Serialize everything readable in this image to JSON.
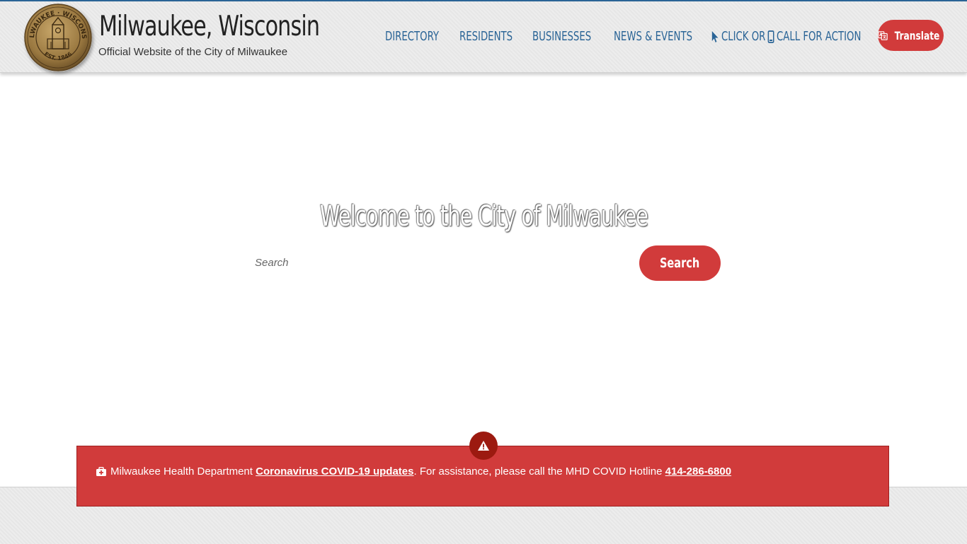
{
  "header": {
    "site_title": "Milwaukee, Wisconsin",
    "site_subtitle": "Official Website of the City of Milwaukee",
    "seal_text": "MILWAUKEE WISCONSIN EST. 1846"
  },
  "nav": {
    "items": [
      {
        "label": "DIRECTORY"
      },
      {
        "label": "RESIDENTS"
      },
      {
        "label": "BUSINESSES"
      },
      {
        "label": "NEWS & EVENTS"
      }
    ],
    "cta_click": "CLICK OR",
    "cta_call": "CALL FOR ACTION",
    "translate_label": "Translate"
  },
  "hero": {
    "welcome": "Welcome to the City of Milwaukee",
    "search_placeholder": "Search",
    "search_button": "Search"
  },
  "alert": {
    "prefix": "Milwaukee Health Department",
    "link": "Coronavirus COVID-19 updates",
    "middle": ". For assistance, please call the MHD COVID Hotline",
    "phone": "414-286-6800"
  },
  "colors": {
    "accent_red": "#d13b3b",
    "nav_blue": "#2a6496",
    "alert_icon_bg": "#9c1a10"
  }
}
